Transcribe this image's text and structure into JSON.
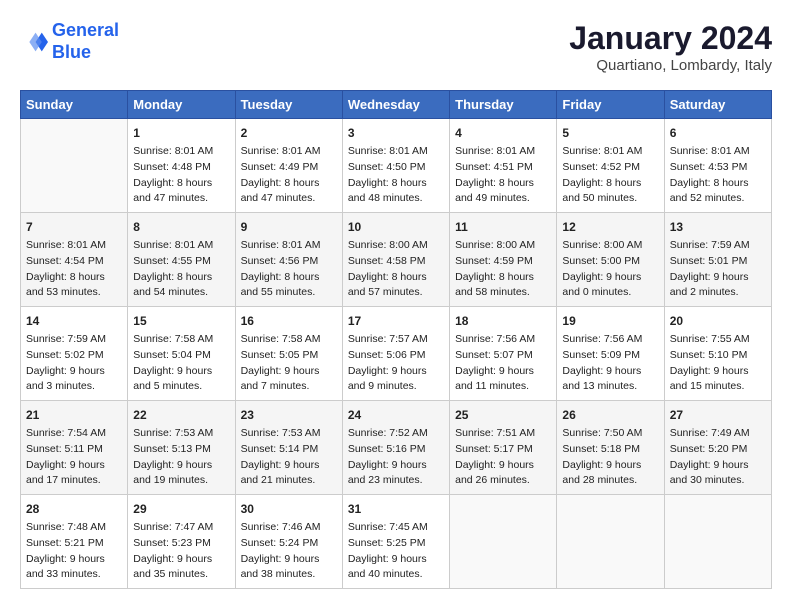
{
  "logo": {
    "line1": "General",
    "line2": "Blue"
  },
  "title": "January 2024",
  "subtitle": "Quartiano, Lombardy, Italy",
  "days_header": [
    "Sunday",
    "Monday",
    "Tuesday",
    "Wednesday",
    "Thursday",
    "Friday",
    "Saturday"
  ],
  "weeks": [
    [
      {
        "day": "",
        "info": ""
      },
      {
        "day": "1",
        "info": "Sunrise: 8:01 AM\nSunset: 4:48 PM\nDaylight: 8 hours\nand 47 minutes."
      },
      {
        "day": "2",
        "info": "Sunrise: 8:01 AM\nSunset: 4:49 PM\nDaylight: 8 hours\nand 47 minutes."
      },
      {
        "day": "3",
        "info": "Sunrise: 8:01 AM\nSunset: 4:50 PM\nDaylight: 8 hours\nand 48 minutes."
      },
      {
        "day": "4",
        "info": "Sunrise: 8:01 AM\nSunset: 4:51 PM\nDaylight: 8 hours\nand 49 minutes."
      },
      {
        "day": "5",
        "info": "Sunrise: 8:01 AM\nSunset: 4:52 PM\nDaylight: 8 hours\nand 50 minutes."
      },
      {
        "day": "6",
        "info": "Sunrise: 8:01 AM\nSunset: 4:53 PM\nDaylight: 8 hours\nand 52 minutes."
      }
    ],
    [
      {
        "day": "7",
        "info": "Sunrise: 8:01 AM\nSunset: 4:54 PM\nDaylight: 8 hours\nand 53 minutes."
      },
      {
        "day": "8",
        "info": "Sunrise: 8:01 AM\nSunset: 4:55 PM\nDaylight: 8 hours\nand 54 minutes."
      },
      {
        "day": "9",
        "info": "Sunrise: 8:01 AM\nSunset: 4:56 PM\nDaylight: 8 hours\nand 55 minutes."
      },
      {
        "day": "10",
        "info": "Sunrise: 8:00 AM\nSunset: 4:58 PM\nDaylight: 8 hours\nand 57 minutes."
      },
      {
        "day": "11",
        "info": "Sunrise: 8:00 AM\nSunset: 4:59 PM\nDaylight: 8 hours\nand 58 minutes."
      },
      {
        "day": "12",
        "info": "Sunrise: 8:00 AM\nSunset: 5:00 PM\nDaylight: 9 hours\nand 0 minutes."
      },
      {
        "day": "13",
        "info": "Sunrise: 7:59 AM\nSunset: 5:01 PM\nDaylight: 9 hours\nand 2 minutes."
      }
    ],
    [
      {
        "day": "14",
        "info": "Sunrise: 7:59 AM\nSunset: 5:02 PM\nDaylight: 9 hours\nand 3 minutes."
      },
      {
        "day": "15",
        "info": "Sunrise: 7:58 AM\nSunset: 5:04 PM\nDaylight: 9 hours\nand 5 minutes."
      },
      {
        "day": "16",
        "info": "Sunrise: 7:58 AM\nSunset: 5:05 PM\nDaylight: 9 hours\nand 7 minutes."
      },
      {
        "day": "17",
        "info": "Sunrise: 7:57 AM\nSunset: 5:06 PM\nDaylight: 9 hours\nand 9 minutes."
      },
      {
        "day": "18",
        "info": "Sunrise: 7:56 AM\nSunset: 5:07 PM\nDaylight: 9 hours\nand 11 minutes."
      },
      {
        "day": "19",
        "info": "Sunrise: 7:56 AM\nSunset: 5:09 PM\nDaylight: 9 hours\nand 13 minutes."
      },
      {
        "day": "20",
        "info": "Sunrise: 7:55 AM\nSunset: 5:10 PM\nDaylight: 9 hours\nand 15 minutes."
      }
    ],
    [
      {
        "day": "21",
        "info": "Sunrise: 7:54 AM\nSunset: 5:11 PM\nDaylight: 9 hours\nand 17 minutes."
      },
      {
        "day": "22",
        "info": "Sunrise: 7:53 AM\nSunset: 5:13 PM\nDaylight: 9 hours\nand 19 minutes."
      },
      {
        "day": "23",
        "info": "Sunrise: 7:53 AM\nSunset: 5:14 PM\nDaylight: 9 hours\nand 21 minutes."
      },
      {
        "day": "24",
        "info": "Sunrise: 7:52 AM\nSunset: 5:16 PM\nDaylight: 9 hours\nand 23 minutes."
      },
      {
        "day": "25",
        "info": "Sunrise: 7:51 AM\nSunset: 5:17 PM\nDaylight: 9 hours\nand 26 minutes."
      },
      {
        "day": "26",
        "info": "Sunrise: 7:50 AM\nSunset: 5:18 PM\nDaylight: 9 hours\nand 28 minutes."
      },
      {
        "day": "27",
        "info": "Sunrise: 7:49 AM\nSunset: 5:20 PM\nDaylight: 9 hours\nand 30 minutes."
      }
    ],
    [
      {
        "day": "28",
        "info": "Sunrise: 7:48 AM\nSunset: 5:21 PM\nDaylight: 9 hours\nand 33 minutes."
      },
      {
        "day": "29",
        "info": "Sunrise: 7:47 AM\nSunset: 5:23 PM\nDaylight: 9 hours\nand 35 minutes."
      },
      {
        "day": "30",
        "info": "Sunrise: 7:46 AM\nSunset: 5:24 PM\nDaylight: 9 hours\nand 38 minutes."
      },
      {
        "day": "31",
        "info": "Sunrise: 7:45 AM\nSunset: 5:25 PM\nDaylight: 9 hours\nand 40 minutes."
      },
      {
        "day": "",
        "info": ""
      },
      {
        "day": "",
        "info": ""
      },
      {
        "day": "",
        "info": ""
      }
    ]
  ]
}
